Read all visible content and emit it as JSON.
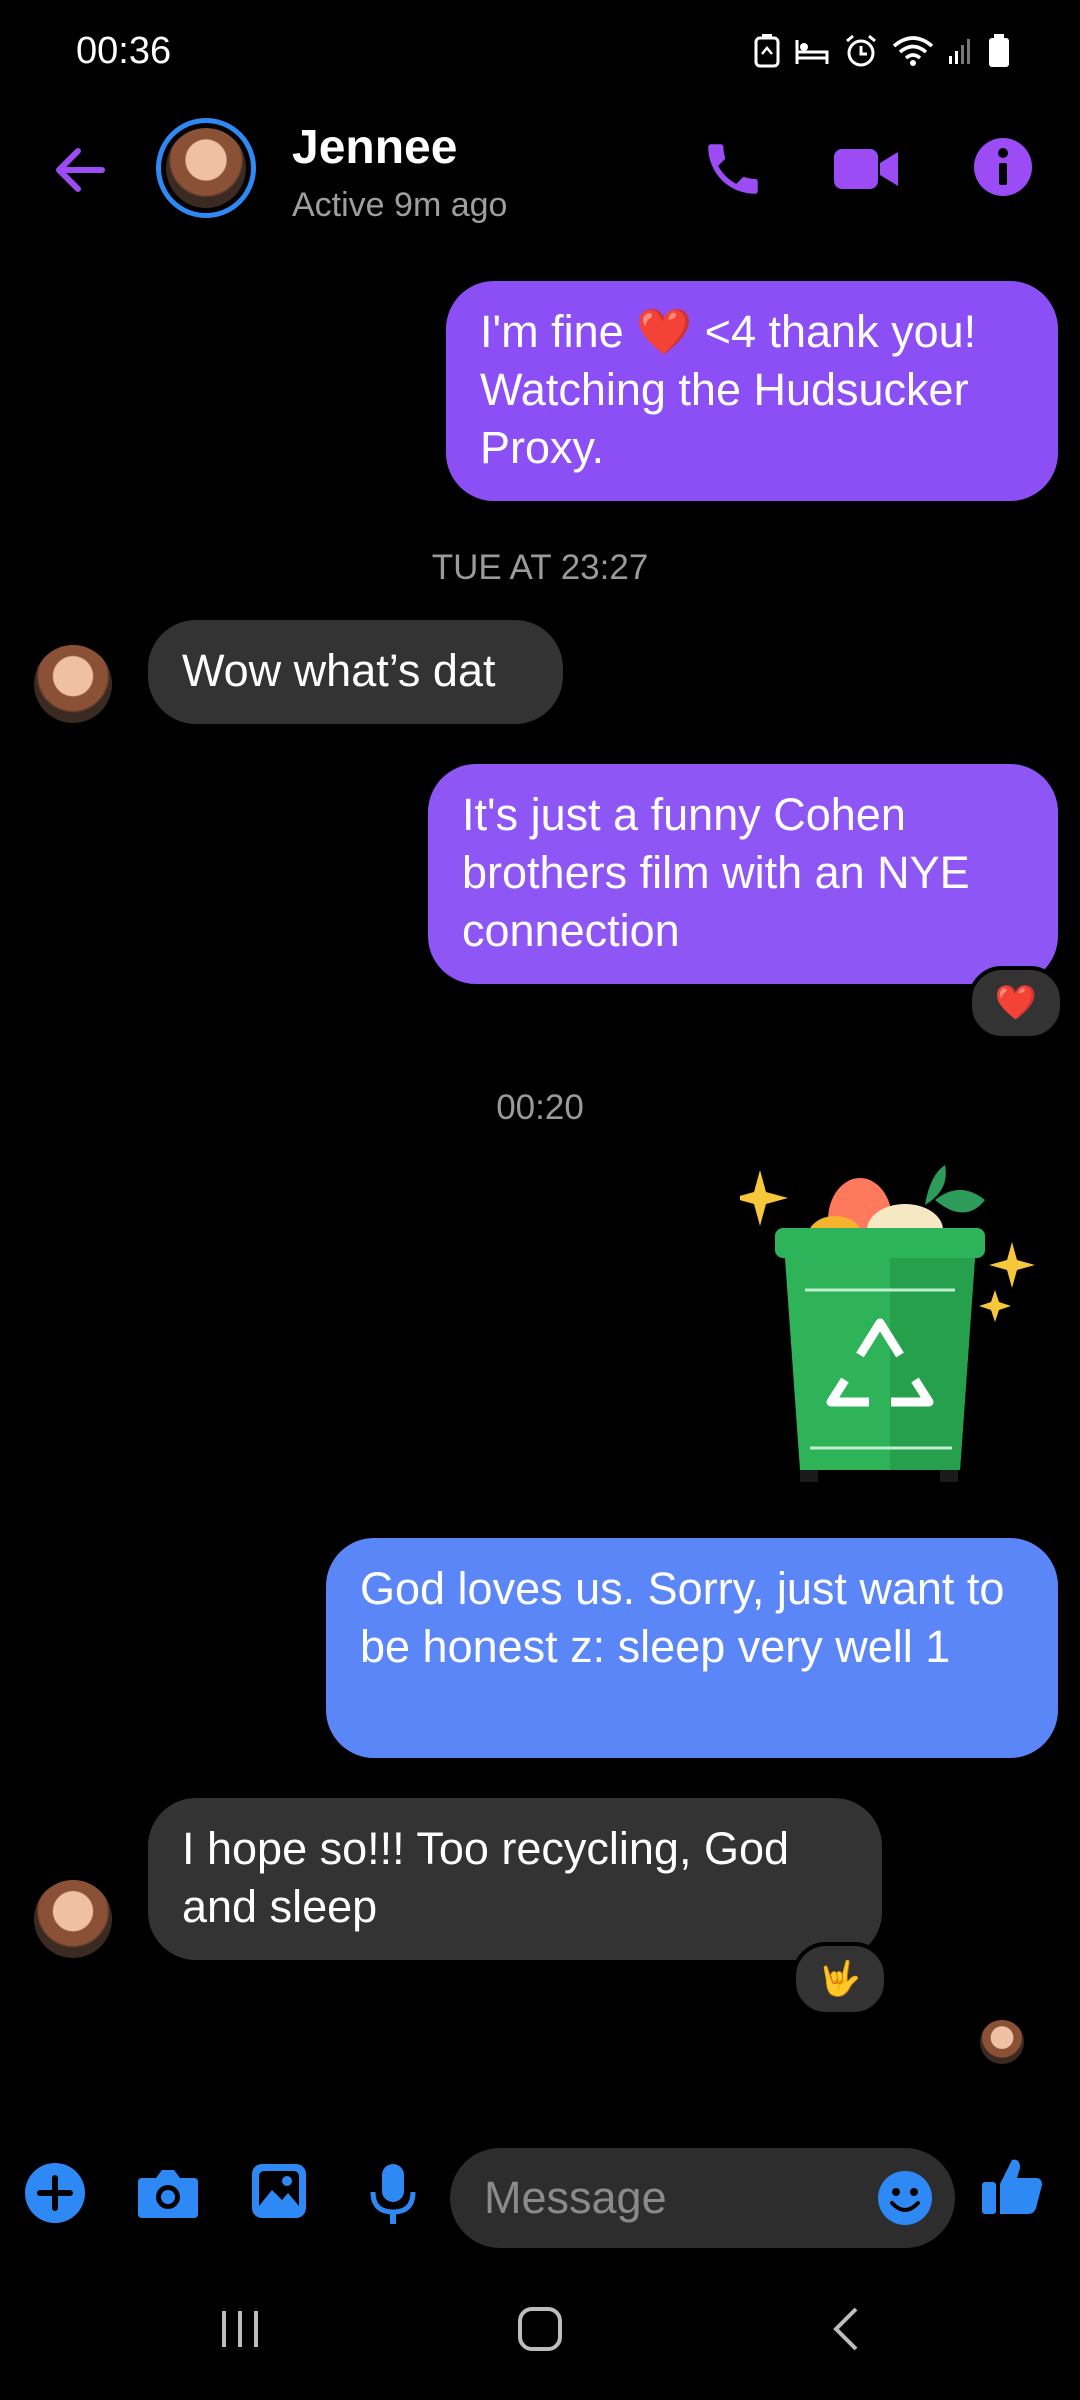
{
  "status_bar": {
    "time": "00:36"
  },
  "header": {
    "contact_name": "Jennee",
    "contact_status": "Active 9m ago",
    "icons": [
      "back-arrow-icon",
      "phone-icon",
      "video-camera-icon",
      "info-icon"
    ]
  },
  "messages": [
    {
      "type": "outgoing",
      "text_before": "I'm fine ",
      "emoji": "❤️",
      "text_after": " <4 thank you! Watching the Hudsucker Proxy."
    },
    {
      "type": "timestamp",
      "text": "TUE AT 23:27"
    },
    {
      "type": "incoming",
      "text": "Wow what’s dat"
    },
    {
      "type": "outgoing",
      "text": "It's just a funny Cohen brothers film with an NYE connection",
      "reaction": "❤️"
    },
    {
      "type": "timestamp",
      "text": "00:20"
    },
    {
      "type": "sticker",
      "name": "recycling-bin-sticker"
    },
    {
      "type": "outgoing",
      "text": "God loves us. Sorry, just want to be honest z: sleep very well 1"
    },
    {
      "type": "incoming",
      "text": "I hope so!!! Too recycling, God and sleep",
      "reaction": "🤟"
    }
  ],
  "composer": {
    "placeholder": "Message",
    "icons": [
      "add-icon",
      "camera-icon",
      "gallery-icon",
      "microphone-icon",
      "emoji-icon",
      "thumbs-up-icon"
    ]
  },
  "colors": {
    "accent_purple": "#9b4cf5",
    "accent_blue": "#2f89f5",
    "outgoing_bubble": "#8c4ff5",
    "outgoing_bubble_blue": "#5b86f7",
    "incoming_bubble": "#333333"
  }
}
